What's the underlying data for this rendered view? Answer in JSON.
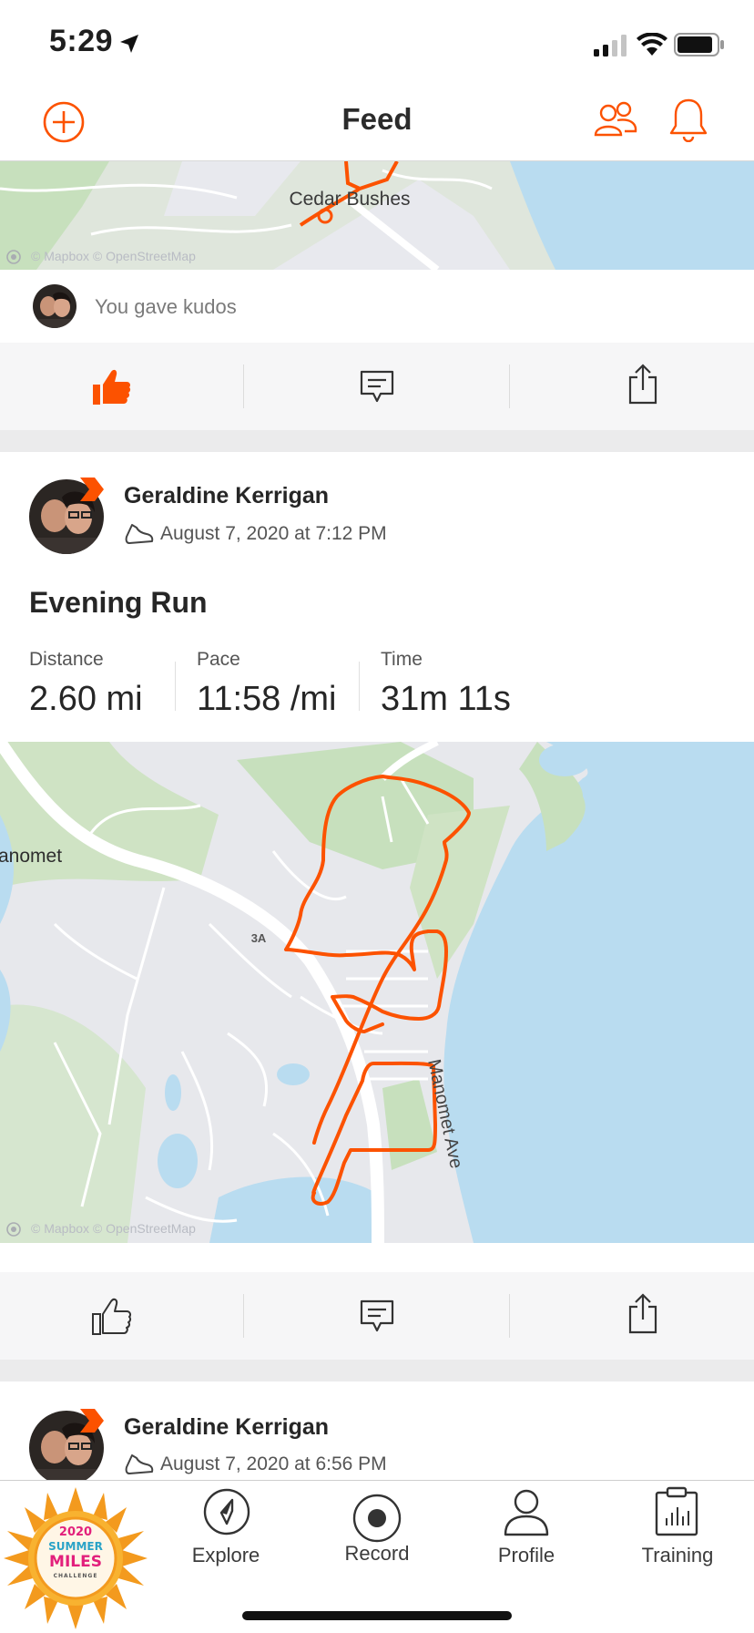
{
  "status_bar": {
    "time": "5:29",
    "icons": [
      "location-arrow-icon",
      "cellular-signal-icon",
      "wifi-icon",
      "battery-icon"
    ]
  },
  "header": {
    "title": "Feed",
    "left_icon": "add-circle-icon",
    "right_icons": [
      "find-friends-icon",
      "notifications-bell-icon"
    ]
  },
  "accent_color": "#fc5200",
  "prev_post": {
    "map_label": "Cedar Bushes",
    "map_attribution": "© Mapbox © OpenStreetMap",
    "kudos_text": "You gave kudos",
    "kudos_given": true
  },
  "activity": {
    "athlete": "Geraldine Kerrigan",
    "date": "August 7, 2020 at 7:12 PM",
    "title": "Evening Run",
    "stats": [
      {
        "label": "Distance",
        "value": "2.60 mi"
      },
      {
        "label": "Pace",
        "value": "11:58 /mi"
      },
      {
        "label": "Time",
        "value": "31m 11s"
      }
    ],
    "map_labels": {
      "place": "anomet",
      "route": "3A",
      "street": "Manomet Ave"
    },
    "map_attribution": "© Mapbox © OpenStreetMap"
  },
  "next_post": {
    "athlete": "Geraldine Kerrigan",
    "date": "August 7, 2020 at 6:56 PM"
  },
  "badge": {
    "year": "2020",
    "line1": "SUMMER",
    "line2": "MILES",
    "line3": "CHALLENGE"
  },
  "tabs": [
    {
      "label": "Explore",
      "icon": "explore-compass-icon"
    },
    {
      "label": "Record",
      "icon": "record-icon"
    },
    {
      "label": "Profile",
      "icon": "profile-person-icon"
    },
    {
      "label": "Training",
      "icon": "training-clipboard-icon"
    }
  ]
}
